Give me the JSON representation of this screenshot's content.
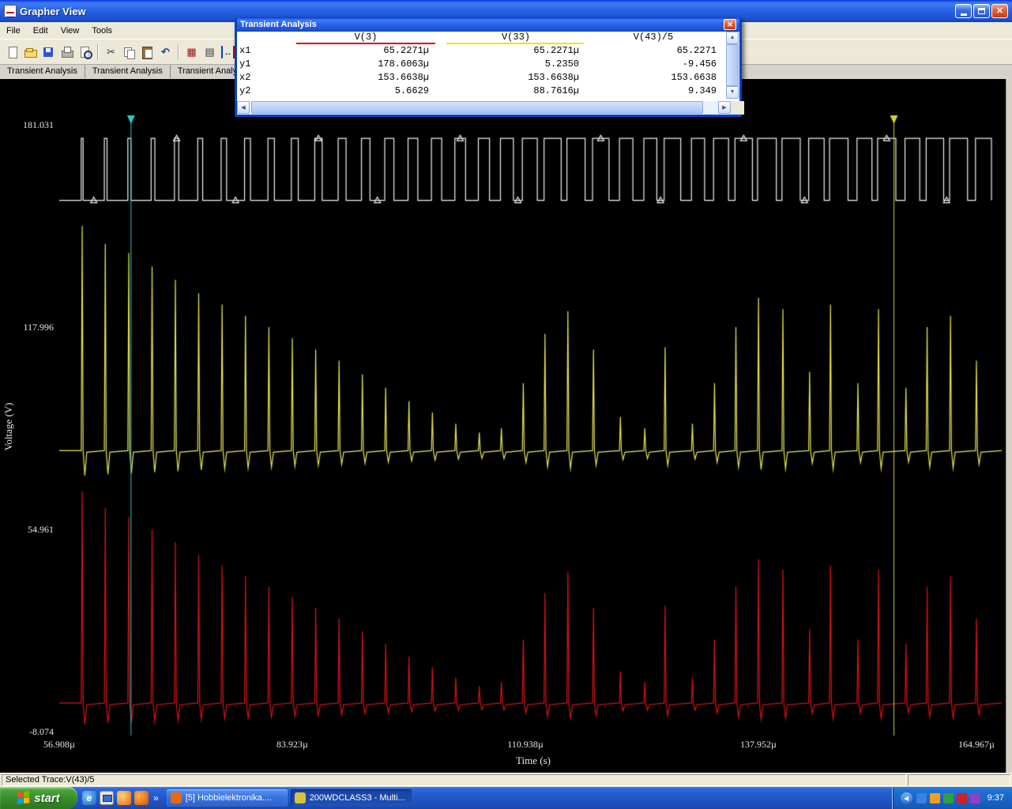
{
  "window": {
    "title": "Grapher View"
  },
  "menu": {
    "items": [
      "File",
      "Edit",
      "View",
      "Tools"
    ]
  },
  "toolbar": {
    "groups": [
      [
        "new-document",
        "open-folder",
        "save",
        "print",
        "print-preview"
      ],
      [
        "cut",
        "copy",
        "paste",
        "undo"
      ],
      [
        "grid",
        "legend",
        "cursors"
      ]
    ]
  },
  "tabs": [
    "Transient Analysis",
    "Transient Analysis",
    "Transient Analysis"
  ],
  "cursor_window": {
    "title": "Transient Analysis",
    "columns": [
      {
        "label": "V(3)",
        "underline_color": "#e00000"
      },
      {
        "label": "V(33)",
        "underline_color": "#e8e800"
      },
      {
        "label": "V(43)/5",
        "underline_color": "#ffffff"
      }
    ],
    "rows": [
      {
        "label": "x1",
        "values": [
          "65.2271µ",
          "65.2271µ",
          "65.2271"
        ]
      },
      {
        "label": "y1",
        "values": [
          "178.6063µ",
          "5.2350",
          "-9.456"
        ]
      },
      {
        "label": "x2",
        "values": [
          "153.6638µ",
          "153.6638µ",
          "153.6638"
        ]
      },
      {
        "label": "y2",
        "values": [
          "5.6629",
          "88.7616µ",
          "9.349"
        ]
      }
    ]
  },
  "chart_data": {
    "type": "line",
    "title": "Transient Analysis",
    "xlabel": "Time (s)",
    "ylabel": "Voltage (V)",
    "x_ticks": [
      "56.908µ",
      "83.923µ",
      "110.938µ",
      "137.952µ",
      "164.967µ"
    ],
    "x_tick_values_us": [
      56.908,
      83.923,
      110.938,
      137.952,
      164.967
    ],
    "y_ticks": [
      "181.031",
      "117.996",
      "54.961",
      "-8.074"
    ],
    "y_tick_values": [
      181.031,
      117.996,
      54.961,
      -8.074
    ],
    "xlim_us": [
      56.908,
      164.967
    ],
    "ylim": [
      -8.074,
      181.031
    ],
    "grid": false,
    "background": "#000000",
    "series": [
      {
        "name": "V(3)",
        "color": "#f2f2f2",
        "kind": "pwm-square"
      },
      {
        "name": "V(33)",
        "color": "#e6e64f",
        "kind": "flyback-spikes",
        "base_v": 79.5,
        "spike_max_v": 70,
        "dip_max_v": 6.5
      },
      {
        "name": "V(43)/5",
        "color": "#d91414",
        "kind": "flyback-spikes",
        "base_v": 0.8,
        "spike_max_v": 66,
        "dip_max_v": 5.5
      }
    ],
    "square": {
      "high_v": 176.8,
      "low_v": 157.5
    },
    "modulation": [
      -1.0,
      -0.92,
      -0.88,
      -0.82,
      -0.76,
      -0.7,
      -0.65,
      -0.6,
      -0.55,
      -0.5,
      -0.45,
      -0.4,
      -0.34,
      -0.28,
      -0.22,
      -0.17,
      -0.12,
      -0.08,
      0.1,
      0.3,
      0.52,
      0.62,
      0.45,
      0.15,
      0.1,
      0.46,
      0.12,
      0.3,
      0.55,
      0.68,
      0.63,
      0.35,
      0.65,
      0.3,
      0.63,
      0.28,
      0.55,
      0.6,
      0.4
    ],
    "cursors": [
      {
        "name": "cursor-1",
        "x_us": 65.2271,
        "color": "#2fc8c8"
      },
      {
        "name": "cursor-2",
        "x_us": 153.6638,
        "color": "#cfcf3a"
      }
    ]
  },
  "status_bar": {
    "text": "Selected Trace:V(43)/5"
  },
  "taskbar": {
    "start_label": "start",
    "quick_launch": [
      {
        "name": "internet-explorer",
        "class": "ql-ie",
        "glyph": "e"
      },
      {
        "name": "show-desktop",
        "class": "ql-desktop",
        "glyph": ""
      },
      {
        "name": "media-player",
        "class": "ql-media",
        "glyph": ""
      },
      {
        "name": "firefox",
        "class": "ql-firefox",
        "glyph": ""
      }
    ],
    "tasks": [
      {
        "label": "[5] Hobbielektronika....",
        "icon_color": "#e86a10",
        "active": false
      },
      {
        "label": "200WDCLASS3 - Multi...",
        "icon_color": "#d8c43a",
        "active": true
      }
    ],
    "tray": {
      "icons": [
        {
          "name": "volume",
          "color": "#3a80e8"
        },
        {
          "name": "updates",
          "color": "#f0a020"
        },
        {
          "name": "antivirus",
          "color": "#2fa040"
        },
        {
          "name": "security",
          "color": "#d02020"
        },
        {
          "name": "messenger",
          "color": "#9040c0"
        }
      ],
      "time": "9:37"
    }
  }
}
